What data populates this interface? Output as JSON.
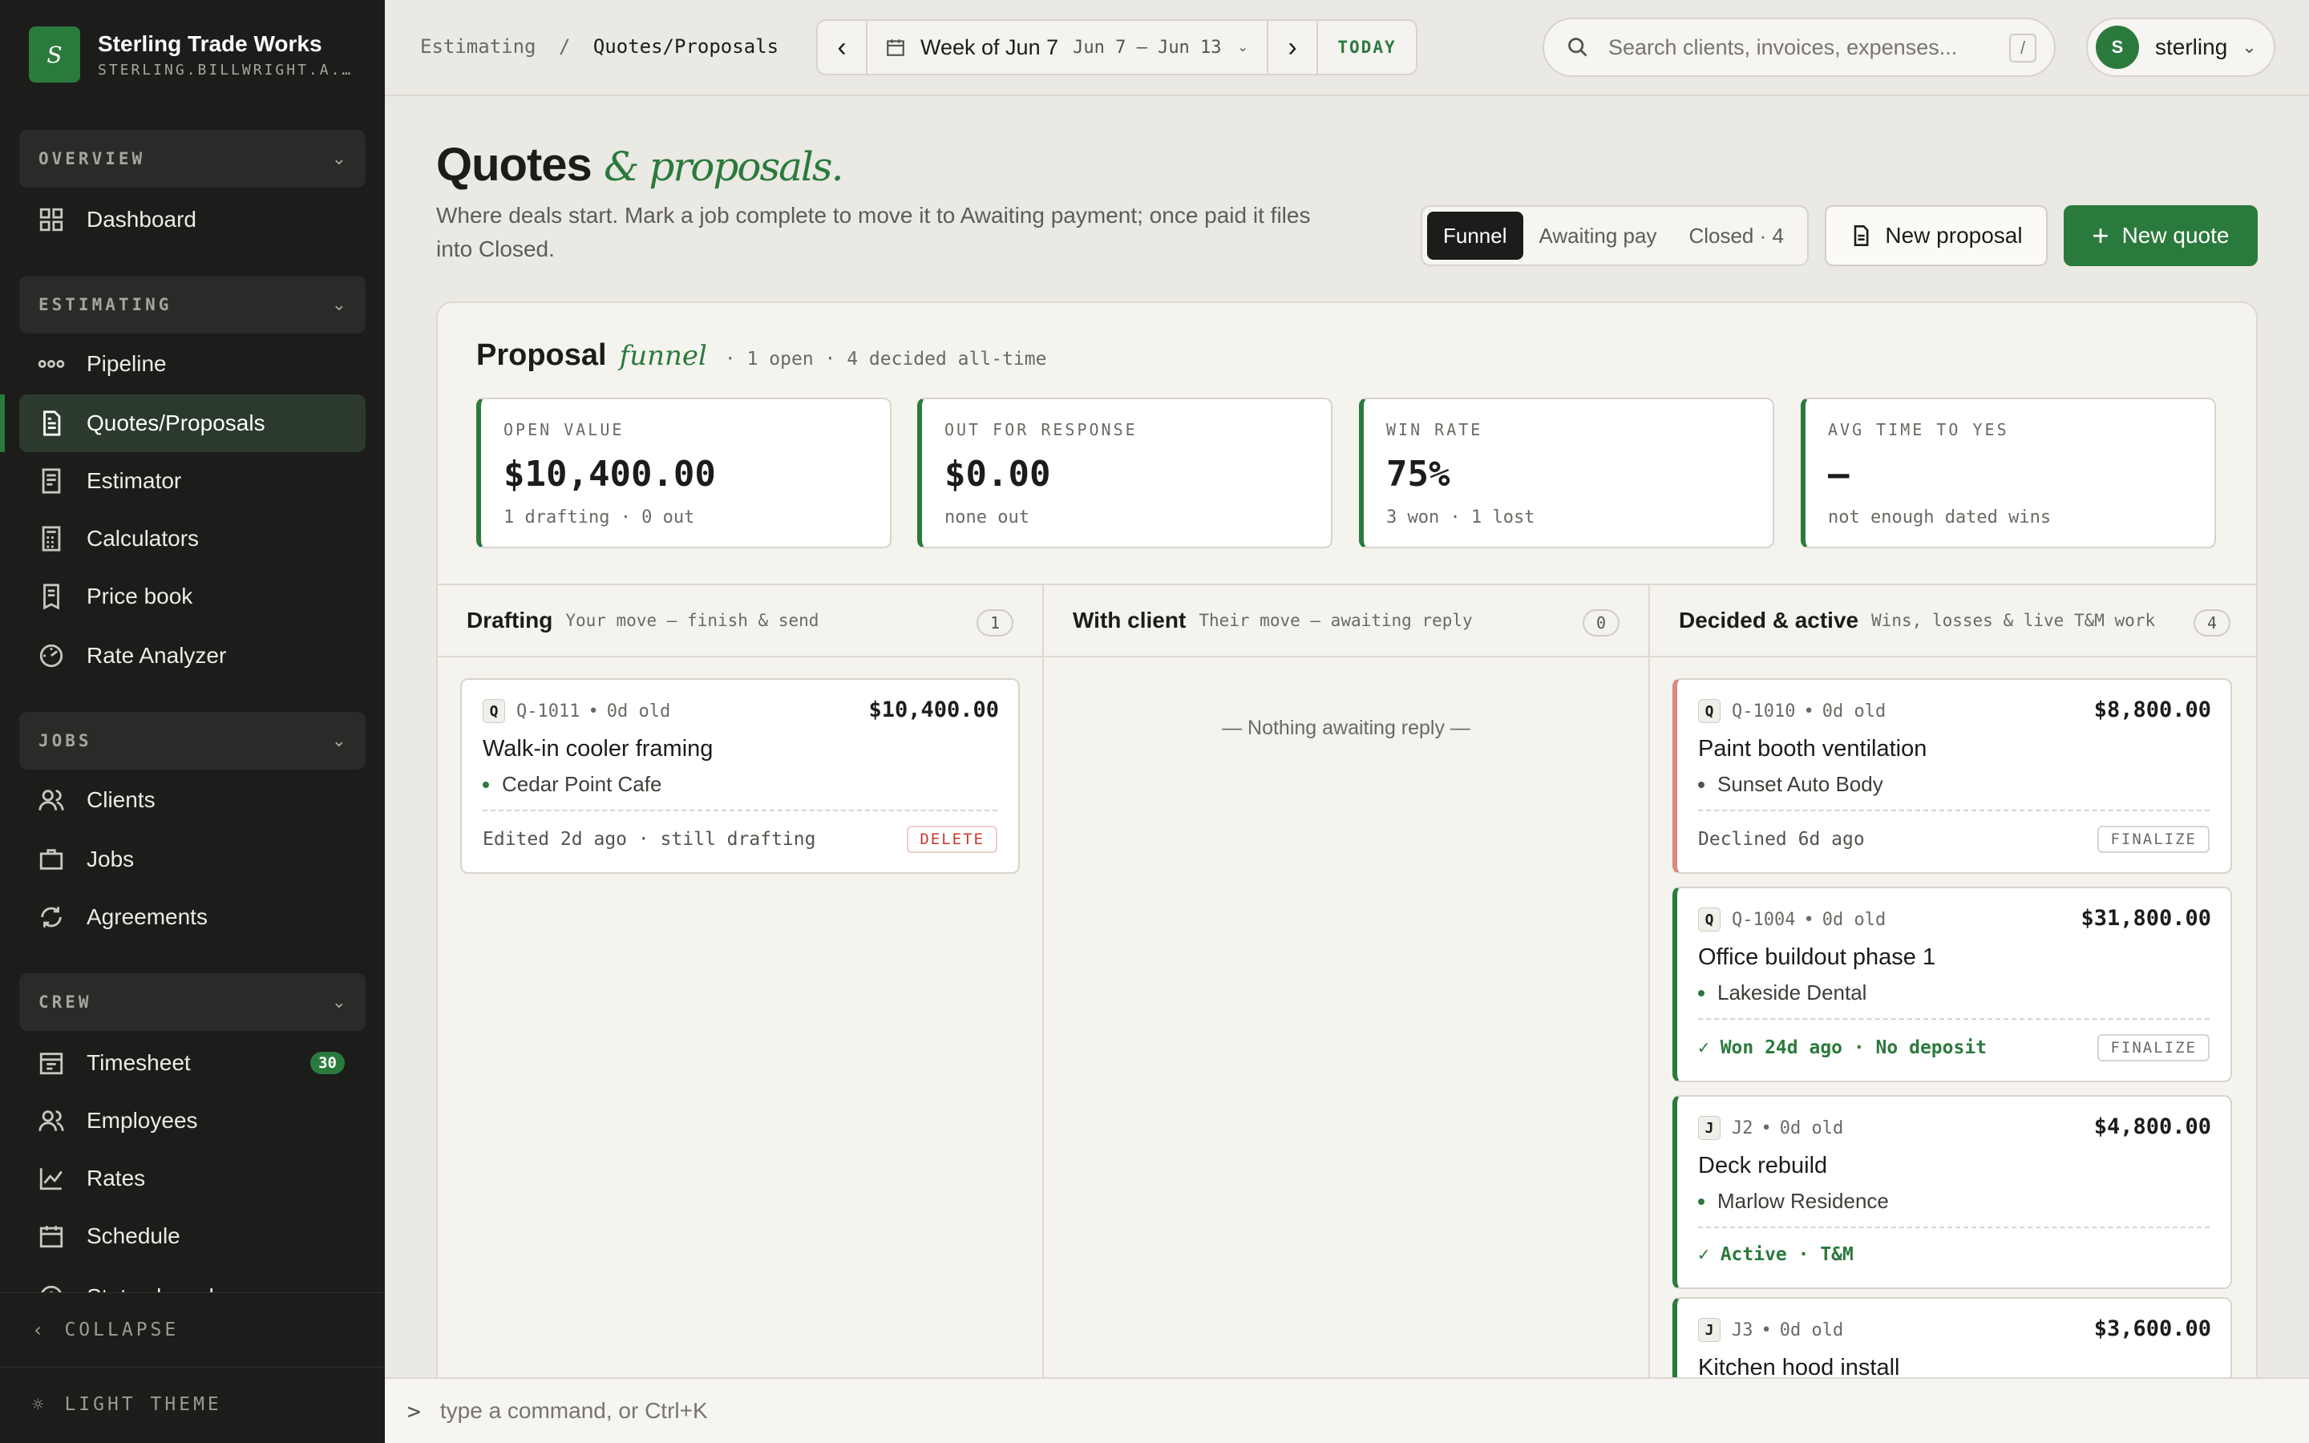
{
  "brand": {
    "logo": "S",
    "name": "Sterling Trade Works",
    "domain": "STERLING.BILLWRIGHT.A..."
  },
  "sidebar": {
    "sections": [
      {
        "label": "OVERVIEW",
        "items": [
          {
            "label": "Dashboard",
            "icon": "grid-icon"
          }
        ]
      },
      {
        "label": "ESTIMATING",
        "items": [
          {
            "label": "Pipeline",
            "icon": "pipeline-icon"
          },
          {
            "label": "Quotes/Proposals",
            "icon": "document-icon",
            "active": true
          },
          {
            "label": "Estimator",
            "icon": "estimator-icon"
          },
          {
            "label": "Calculators",
            "icon": "calculator-icon"
          },
          {
            "label": "Price book",
            "icon": "book-icon"
          },
          {
            "label": "Rate Analyzer",
            "icon": "gauge-icon"
          }
        ]
      },
      {
        "label": "JOBS",
        "items": [
          {
            "label": "Clients",
            "icon": "users-icon"
          },
          {
            "label": "Jobs",
            "icon": "briefcase-icon"
          },
          {
            "label": "Agreements",
            "icon": "refresh-icon"
          }
        ]
      },
      {
        "label": "CREW",
        "items": [
          {
            "label": "Timesheet",
            "icon": "timesheet-icon",
            "badge": "30"
          },
          {
            "label": "Employees",
            "icon": "users-icon"
          },
          {
            "label": "Rates",
            "icon": "chart-icon"
          },
          {
            "label": "Schedule",
            "icon": "calendar-icon"
          },
          {
            "label": "Status board",
            "icon": "clock-icon"
          }
        ]
      }
    ],
    "collapse": "COLLAPSE",
    "theme": "LIGHT THEME"
  },
  "topbar": {
    "breadcrumb": {
      "parent": "Estimating",
      "sep": "/",
      "current": "Quotes/Proposals"
    },
    "week": {
      "label": "Week of Jun 7",
      "range": "Jun 7 – Jun 13",
      "today": "TODAY"
    },
    "search": {
      "placeholder": "Search clients, invoices, expenses...",
      "shortcut": "/"
    },
    "user": {
      "initial": "S",
      "name": "sterling"
    }
  },
  "page": {
    "title": "Quotes",
    "title_accent": "& proposals.",
    "description": "Where deals start. Mark a job complete to move it to Awaiting payment; once paid it files into Closed.",
    "tabs": [
      "Funnel",
      "Awaiting pay",
      "Closed · 4"
    ],
    "active_tab": "Funnel",
    "new_proposal": "New proposal",
    "new_quote": "New quote"
  },
  "funnel": {
    "title": "Proposal",
    "title_accent": "funnel",
    "meta": "· 1 open · 4 decided all-time",
    "stats": [
      {
        "label": "OPEN VALUE",
        "value": "$10,400.00",
        "sub": "1 drafting · 0 out"
      },
      {
        "label": "OUT FOR RESPONSE",
        "value": "$0.00",
        "sub": "none out"
      },
      {
        "label": "WIN RATE",
        "value": "75%",
        "sub": "3 won · 1 lost"
      },
      {
        "label": "AVG TIME TO YES",
        "value": "—",
        "sub": "not enough dated wins"
      }
    ],
    "columns": [
      {
        "title": "Drafting",
        "subtitle": "Your move — finish & send",
        "count": "1"
      },
      {
        "title": "With client",
        "subtitle": "Their move — awaiting reply",
        "count": "0",
        "empty": "— Nothing awaiting reply —"
      },
      {
        "title": "Decided & active",
        "subtitle": "Wins, losses & live T&M work",
        "count": "4"
      }
    ],
    "drafting_cards": [
      {
        "tag": "Q",
        "id": "Q-1011",
        "age": "0d old",
        "amount": "$10,400.00",
        "name": "Walk-in cooler framing",
        "client": "Cedar Point Cafe",
        "footer": "Edited 2d ago · still drafting",
        "action": "DELETE"
      }
    ],
    "decided_cards": [
      {
        "tag": "Q",
        "id": "Q-1010",
        "age": "0d old",
        "amount": "$8,800.00",
        "name": "Paint booth ventilation",
        "client": "Sunset Auto Body",
        "footer": "Declined 6d ago",
        "action": "FINALIZE",
        "status": "lost"
      },
      {
        "tag": "Q",
        "id": "Q-1004",
        "age": "0d old",
        "amount": "$31,800.00",
        "name": "Office buildout phase 1",
        "client": "Lakeside Dental",
        "footer": "✓ Won 24d ago · No deposit",
        "action": "FINALIZE",
        "status": "won"
      },
      {
        "tag": "J",
        "id": "J2",
        "age": "0d old",
        "amount": "$4,800.00",
        "name": "Deck rebuild",
        "client": "Marlow Residence",
        "footer": "✓ Active · T&M",
        "status": "won"
      },
      {
        "tag": "J",
        "id": "J3",
        "age": "0d old",
        "amount": "$3,600.00",
        "name": "Kitchen hood install",
        "status": "won"
      }
    ]
  },
  "command": {
    "prompt": ">",
    "placeholder": "type a command, or Ctrl+K"
  }
}
